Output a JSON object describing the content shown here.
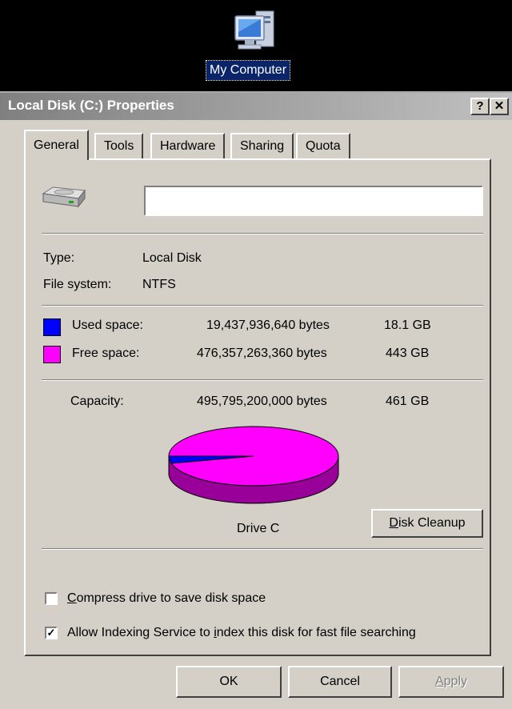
{
  "desktop": {
    "icon_name": "computer-icon",
    "label": "My Computer"
  },
  "dialog": {
    "title": "Local Disk (C:) Properties",
    "help_label": "?",
    "close_label": "✕",
    "tabs": [
      {
        "label": "General",
        "active": true
      },
      {
        "label": "Tools",
        "active": false
      },
      {
        "label": "Hardware",
        "active": false
      },
      {
        "label": "Sharing",
        "active": false
      },
      {
        "label": "Quota",
        "active": false
      }
    ],
    "volume_label": {
      "value": "",
      "placeholder": ""
    },
    "type_label": "Type:",
    "type_value": "Local Disk",
    "fs_label": "File system:",
    "fs_value": "NTFS",
    "used": {
      "label": "Used space:",
      "bytes": "19,437,936,640 bytes",
      "gb": "18.1 GB",
      "color": "#0000ff"
    },
    "free": {
      "label": "Free space:",
      "bytes": "476,357,263,360 bytes",
      "gb": "443 GB",
      "color": "#ff00ff"
    },
    "capacity": {
      "label": "Capacity:",
      "bytes": "495,795,200,000 bytes",
      "gb": "461 GB"
    },
    "drive_caption": "Drive C",
    "cleanup_button": {
      "prefix": "D",
      "rest": "isk Cleanup"
    },
    "compress": {
      "checked": false,
      "prefix": "C",
      "rest": "ompress drive to save disk space"
    },
    "index": {
      "checked": true,
      "pre": "Allow Indexing Service to ",
      "key": "i",
      "post": "ndex this disk for fast file searching"
    },
    "buttons": {
      "ok": "OK",
      "cancel": "Cancel",
      "apply_key": "A",
      "apply_rest": "pply"
    }
  },
  "chart_data": {
    "type": "pie",
    "categories": [
      "Used space",
      "Free space"
    ],
    "values": [
      19437936640,
      476357263360
    ],
    "colors": [
      "#0000ff",
      "#ff00ff"
    ]
  }
}
